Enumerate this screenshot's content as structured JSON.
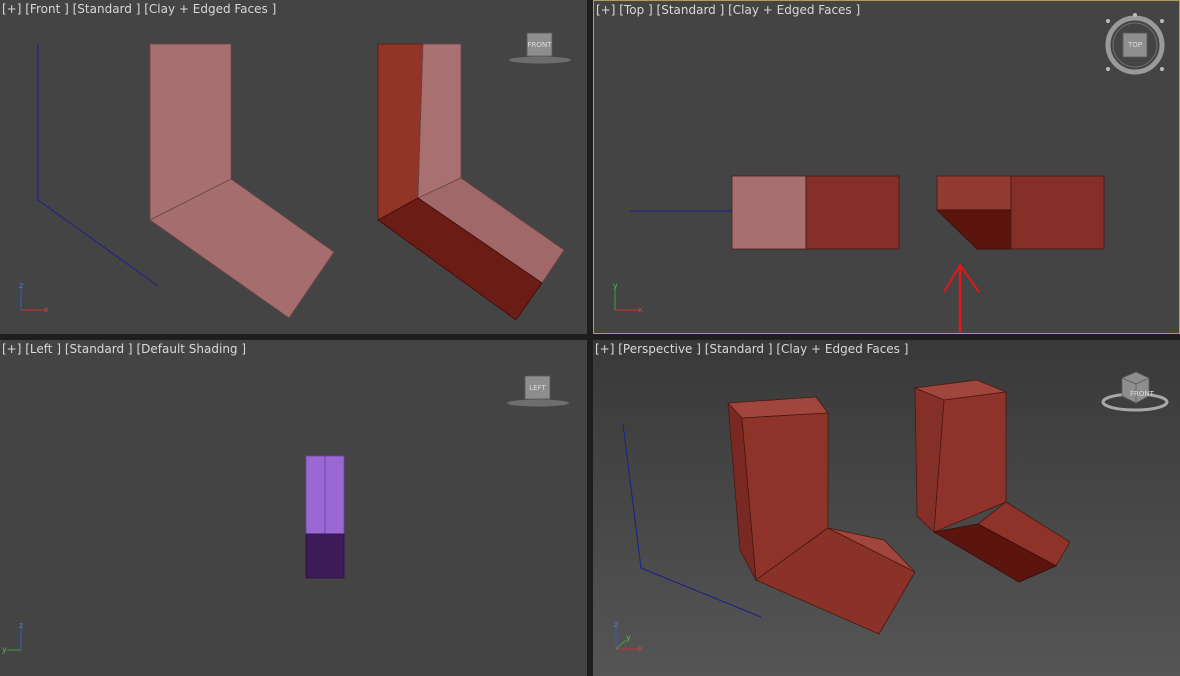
{
  "viewports": {
    "front": {
      "label_parts": [
        "[+]",
        "[Front ]",
        "[Standard ]",
        "[Clay + Edged Faces ]"
      ],
      "viewcube": "FRONT"
    },
    "top": {
      "label_parts": [
        "[+]",
        "[Top ]",
        "[Standard ]",
        "[Clay + Edged Faces ]"
      ],
      "viewcube": "TOP"
    },
    "left": {
      "label_parts": [
        "[+]",
        "[Left ]",
        "[Standard ]",
        "[Default Shading ]"
      ],
      "viewcube": "LEFT"
    },
    "perspective": {
      "label_parts": [
        "[+]",
        "[Perspective ]",
        "[Standard ]",
        "[Clay + Edged Faces ]"
      ],
      "viewcube": "FRONT"
    }
  },
  "axes": {
    "z": "z",
    "y": "y",
    "x": "x"
  },
  "icons": [
    "viewcube-icon",
    "steering-wheel-icon",
    "axis-tripod-icon",
    "arrow-annotation-icon"
  ],
  "colors": {
    "viewport_bg": "#444444",
    "active_border": "#b39b5c",
    "clay_pink": "#a86f70",
    "clay_red": "#843029",
    "clay_dark": "#5c140f",
    "left_purple": "#9a68d2",
    "left_dark_purple": "#3e1b58",
    "annotation_red": "#e01818",
    "grid_blue": "#1d1f8c"
  }
}
